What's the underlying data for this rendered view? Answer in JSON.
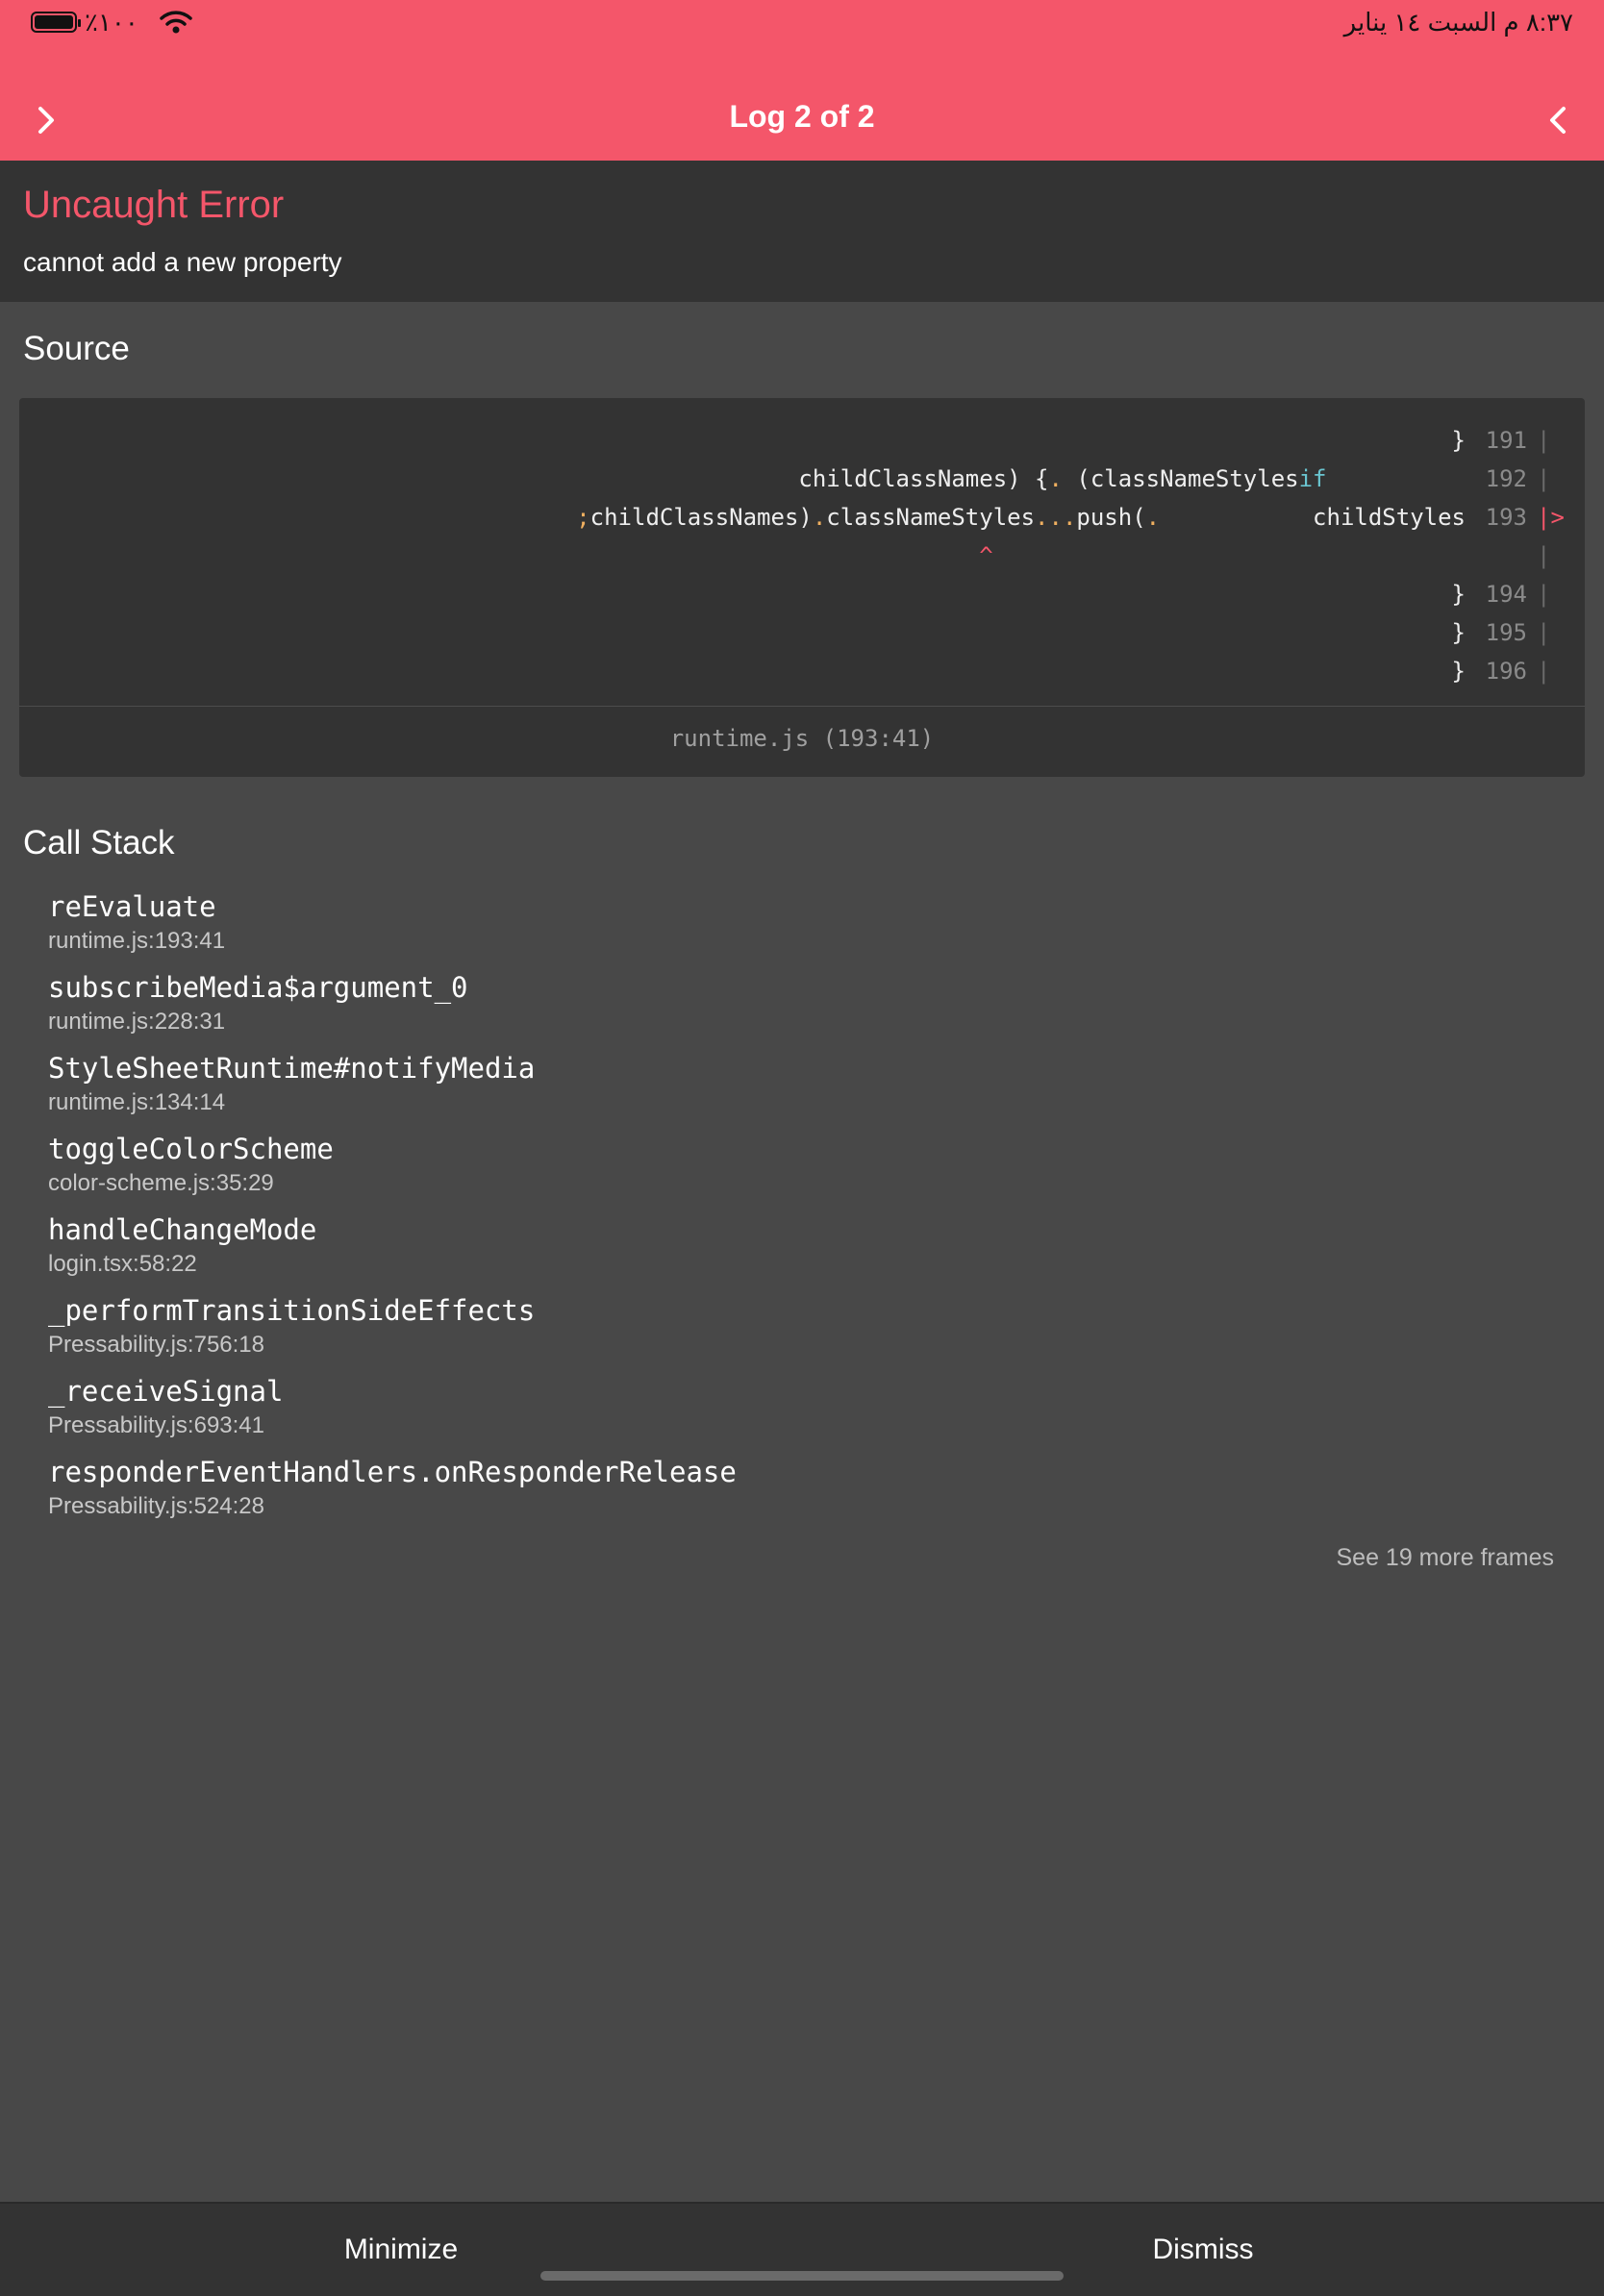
{
  "status_bar": {
    "battery_percent": "٪١٠٠",
    "time_date": "٨:٣٧ م  السبت ١٤ يناير"
  },
  "header": {
    "title": "Log 2 of 2",
    "left_icon": "chevron-right-icon",
    "right_icon": "chevron-left-icon",
    "background_color": "#f4566a"
  },
  "error": {
    "title": "Uncaught Error",
    "message": "cannot add a new property",
    "title_color": "#f4566a"
  },
  "source": {
    "heading": "Source",
    "lines": [
      {
        "num": "191",
        "text": "}",
        "gutter": "|"
      },
      {
        "num": "192",
        "text": "if (classNameStyles) {.  childClassNames)",
        "gutter": "|"
      },
      {
        "num": "193",
        "text": "childStyles  .)push...classNameStyles.(childClassNames;",
        "gutter": "|>"
      },
      {
        "num": "",
        "text": "^",
        "gutter": "|"
      },
      {
        "num": "194",
        "text": "}",
        "gutter": "|"
      },
      {
        "num": "195",
        "text": "}",
        "gutter": "|"
      },
      {
        "num": "196",
        "text": "}",
        "gutter": "|"
      }
    ],
    "file_location": "runtime.js (193:41)"
  },
  "call_stack": {
    "heading": "Call Stack",
    "frames": [
      {
        "name": "reEvaluate",
        "location": "runtime.js:193:41"
      },
      {
        "name": "subscribeMedia$argument_0",
        "location": "runtime.js:228:31"
      },
      {
        "name": "StyleSheetRuntime#notifyMedia",
        "location": "runtime.js:134:14"
      },
      {
        "name": "toggleColorScheme",
        "location": "color-scheme.js:35:29"
      },
      {
        "name": "handleChangeMode",
        "location": "login.tsx:58:22"
      },
      {
        "name": "_performTransitionSideEffects",
        "location": "Pressability.js:756:18"
      },
      {
        "name": "_receiveSignal",
        "location": "Pressability.js:693:41"
      },
      {
        "name": "responderEventHandlers.onResponderRelease",
        "location": "Pressability.js:524:28"
      }
    ],
    "more_frames": "See 19 more frames"
  },
  "bottom_bar": {
    "minimize_label": "Minimize",
    "dismiss_label": "Dismiss"
  }
}
